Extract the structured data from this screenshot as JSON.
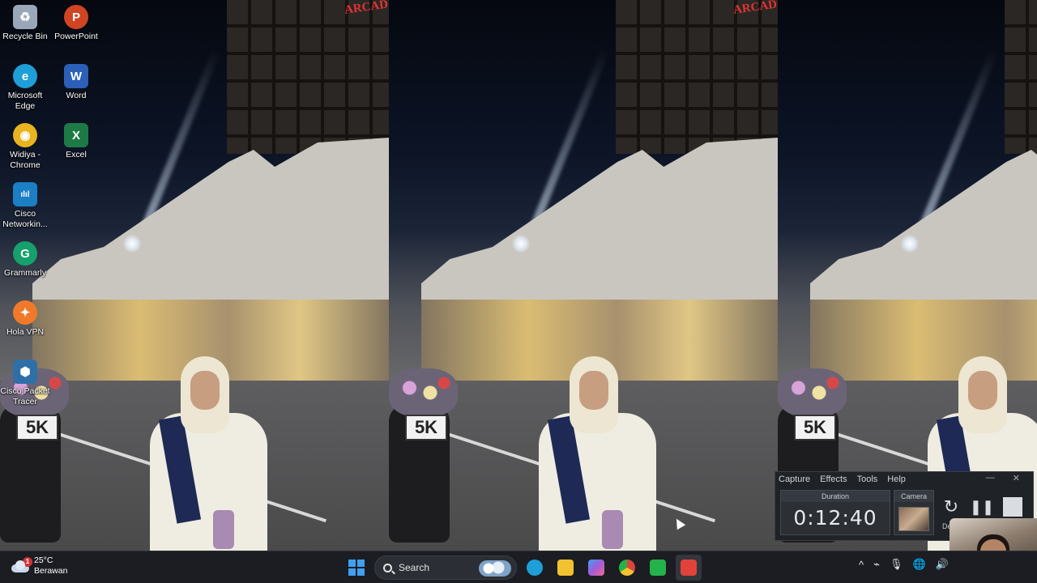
{
  "desktop": {
    "icons": [
      {
        "label": "Recycle Bin",
        "icon": "recycle-bin-icon",
        "color": "#9aa7b8"
      },
      {
        "label": "PowerPoint",
        "icon": "powerpoint-icon",
        "color": "#d04423"
      },
      {
        "label": "Microsoft Edge",
        "icon": "edge-icon",
        "color": "#1e9fd8"
      },
      {
        "label": "Word",
        "icon": "word-icon",
        "color": "#2b5fb8"
      },
      {
        "label": "Widiya - Chrome",
        "icon": "chrome-icon",
        "color": "#e8b41f"
      },
      {
        "label": "Excel",
        "icon": "excel-icon",
        "color": "#1e7a45"
      },
      {
        "label": "Cisco Networkin...",
        "icon": "cisco-icon",
        "color": "#1c7fc6"
      },
      {
        "label": "Grammarly",
        "icon": "grammarly-icon",
        "color": "#15a06d"
      },
      {
        "label": "Hola VPN",
        "icon": "hola-vpn-icon",
        "color": "#f07a2a"
      },
      {
        "label": "Cisco Packet Tracer",
        "icon": "packet-tracer-icon",
        "color": "#2f6fa8"
      }
    ],
    "glyphs": {
      "recycle": "♻",
      "powerpoint": "P",
      "edge": "e",
      "word": "W",
      "chrome": "◉",
      "excel": "X",
      "cisco": "ılıl",
      "grammarly": "G",
      "hola": "✦",
      "packet": "⬢"
    },
    "wallpaper_sign": "ARCADIA",
    "plate_text": "5K"
  },
  "recorder": {
    "menu": [
      "Capture",
      "Effects",
      "Tools",
      "Help"
    ],
    "window_controls": {
      "minimize": "—",
      "close": "✕"
    },
    "duration_title": "Duration",
    "duration_value": "0:12:40",
    "camera_title": "Camera",
    "restart_glyph": "↻",
    "pause_glyph": "❚❚",
    "device_label": "De"
  },
  "taskbar": {
    "weather": {
      "temp": "25°C",
      "condition": "Berawan",
      "badge": "1"
    },
    "search_label": "Search",
    "apps": [
      {
        "icon": "edge-taskbar-icon",
        "color": "#1e9fd8"
      },
      {
        "icon": "file-explorer-icon",
        "color": "#f2c230"
      },
      {
        "icon": "copilot-icon",
        "color": "#a35bd8"
      },
      {
        "icon": "chrome-taskbar-icon",
        "color": "#e8b41f"
      },
      {
        "icon": "camtasia-green-icon",
        "color": "#23b34a"
      },
      {
        "icon": "camtasia-red-icon",
        "color": "#e0433a"
      }
    ],
    "tray": {
      "chevron": "^",
      "network": "⌁",
      "mic": "🎙",
      "globe": "🌐",
      "volume": "🔊"
    }
  }
}
